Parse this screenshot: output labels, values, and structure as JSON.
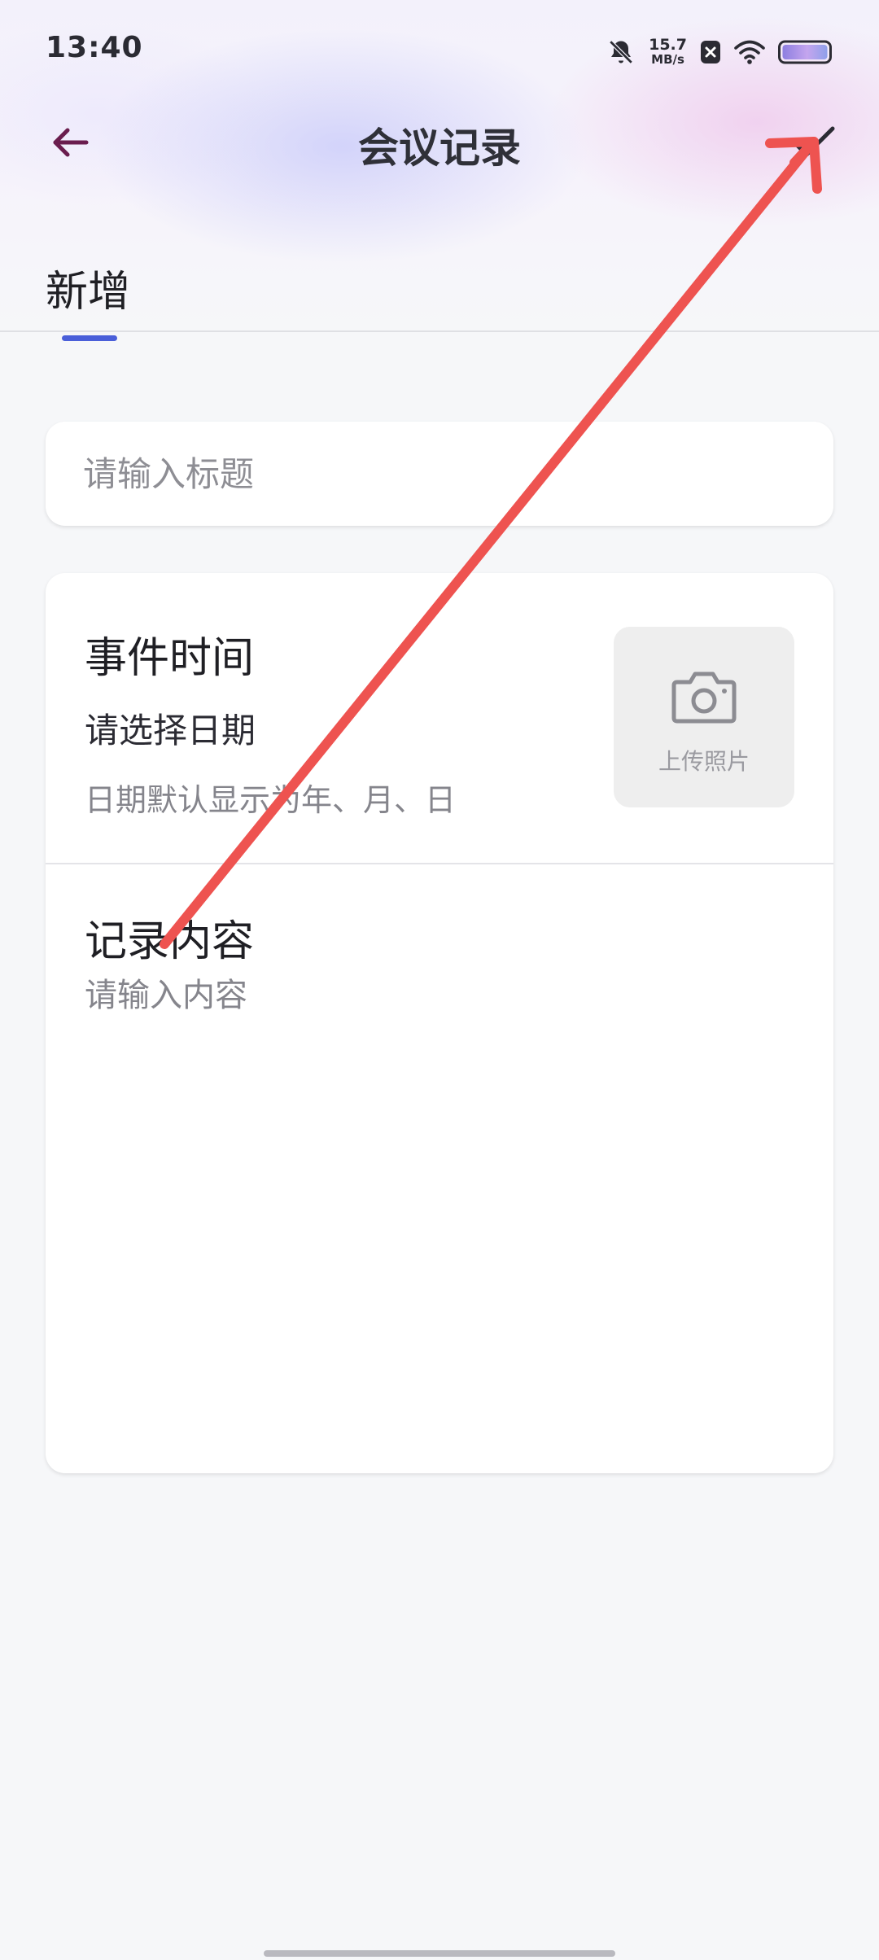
{
  "status_bar": {
    "time": "13:40",
    "net_speed_value": "15.7",
    "net_speed_unit": "MB/s",
    "icons": [
      "mute-bell-icon",
      "close-badge-icon",
      "wifi-icon",
      "battery-icon"
    ]
  },
  "app_bar": {
    "title": "会议记录",
    "back_icon": "arrow-left-icon",
    "confirm_icon": "check-icon"
  },
  "tabs": [
    {
      "label": "新增",
      "active": true
    }
  ],
  "form": {
    "title_placeholder": "请输入标题",
    "event_time_heading": "事件时间",
    "date_picker_label": "请选择日期",
    "date_hint": "日期默认显示为年、月、日",
    "upload_photo_label": "上传照片",
    "content_heading": "记录内容",
    "content_placeholder": "请输入内容"
  },
  "colors": {
    "accent": "#4a5fd9",
    "back_arrow": "#6a1d4e",
    "annotation_arrow": "#ee5350",
    "background": "#f6f7f9"
  }
}
